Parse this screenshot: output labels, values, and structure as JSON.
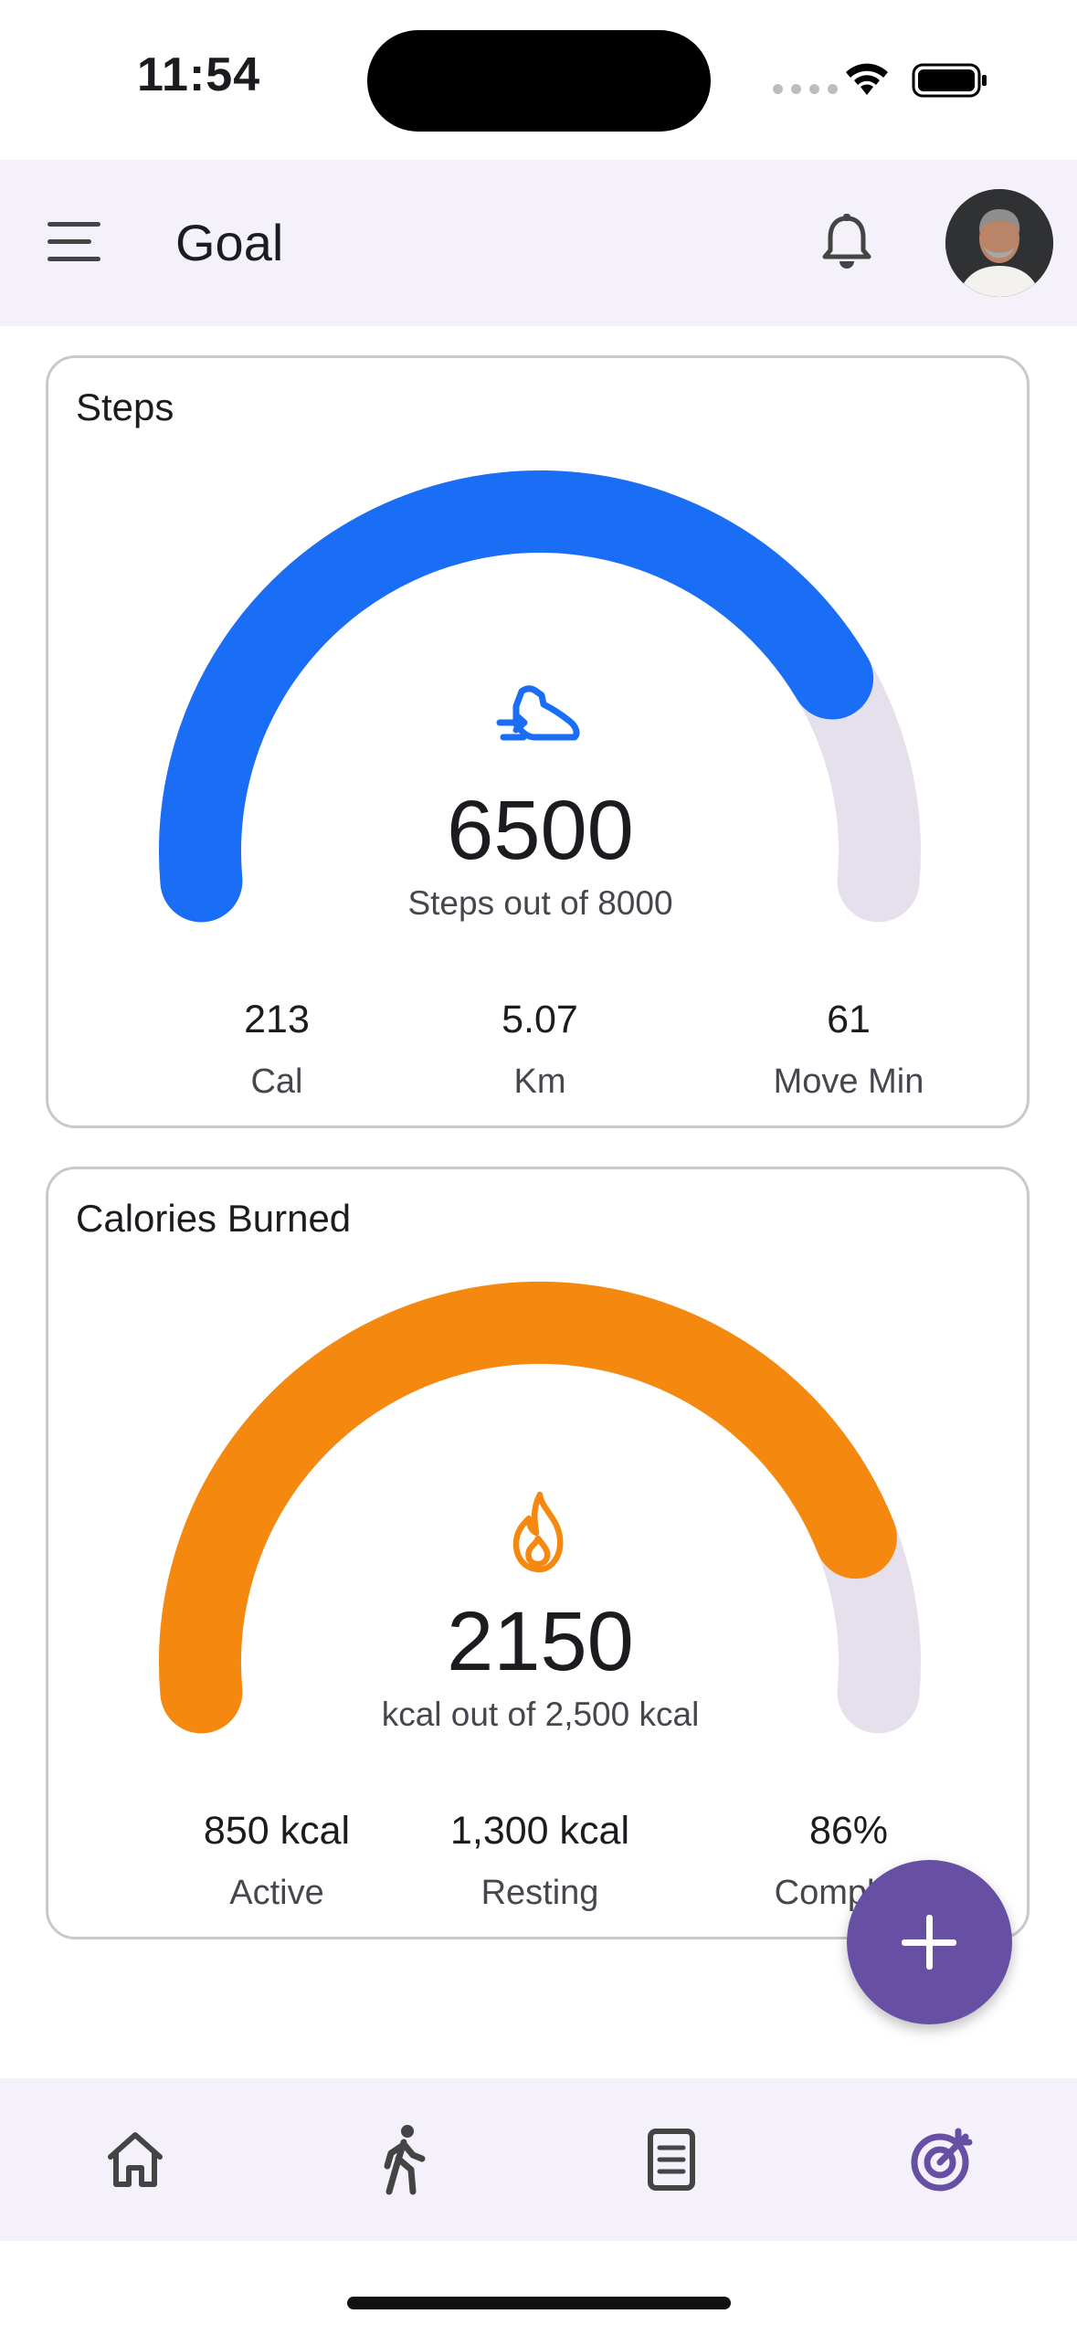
{
  "status_bar": {
    "time": "11:54"
  },
  "app_bar": {
    "title": "Goal",
    "menu_icon": "menu-icon",
    "notification_icon": "bell-icon"
  },
  "steps_card": {
    "title": "Steps",
    "icon": "shoe-icon",
    "value": "6500",
    "caption": "Steps out of 8000",
    "progress": 0.8125,
    "color": "#1A6DF5",
    "track_color": "#E6E0EC",
    "stats": [
      {
        "value": "213",
        "label": "Cal"
      },
      {
        "value": "5.07",
        "label": "Km"
      },
      {
        "value": "61",
        "label": "Move Min"
      }
    ]
  },
  "calories_card": {
    "title": "Calories Burned",
    "icon": "flame-icon",
    "value": "2150",
    "caption": "kcal out of 2,500 kcal",
    "progress": 0.86,
    "color": "#F5890F",
    "track_color": "#E6E0EC",
    "stats": [
      {
        "value": "850 kcal",
        "label": "Active"
      },
      {
        "value": "1,300 kcal",
        "label": "Resting"
      },
      {
        "value": "86%",
        "label": "Complete"
      }
    ]
  },
  "fab": {
    "icon": "plus-icon",
    "color": "#6750A4"
  },
  "bottom_nav": {
    "items": [
      {
        "icon": "home-icon"
      },
      {
        "icon": "walking-icon"
      },
      {
        "icon": "document-icon"
      },
      {
        "icon": "goal-target-icon",
        "active": true
      }
    ],
    "active_color": "#6750A4"
  }
}
